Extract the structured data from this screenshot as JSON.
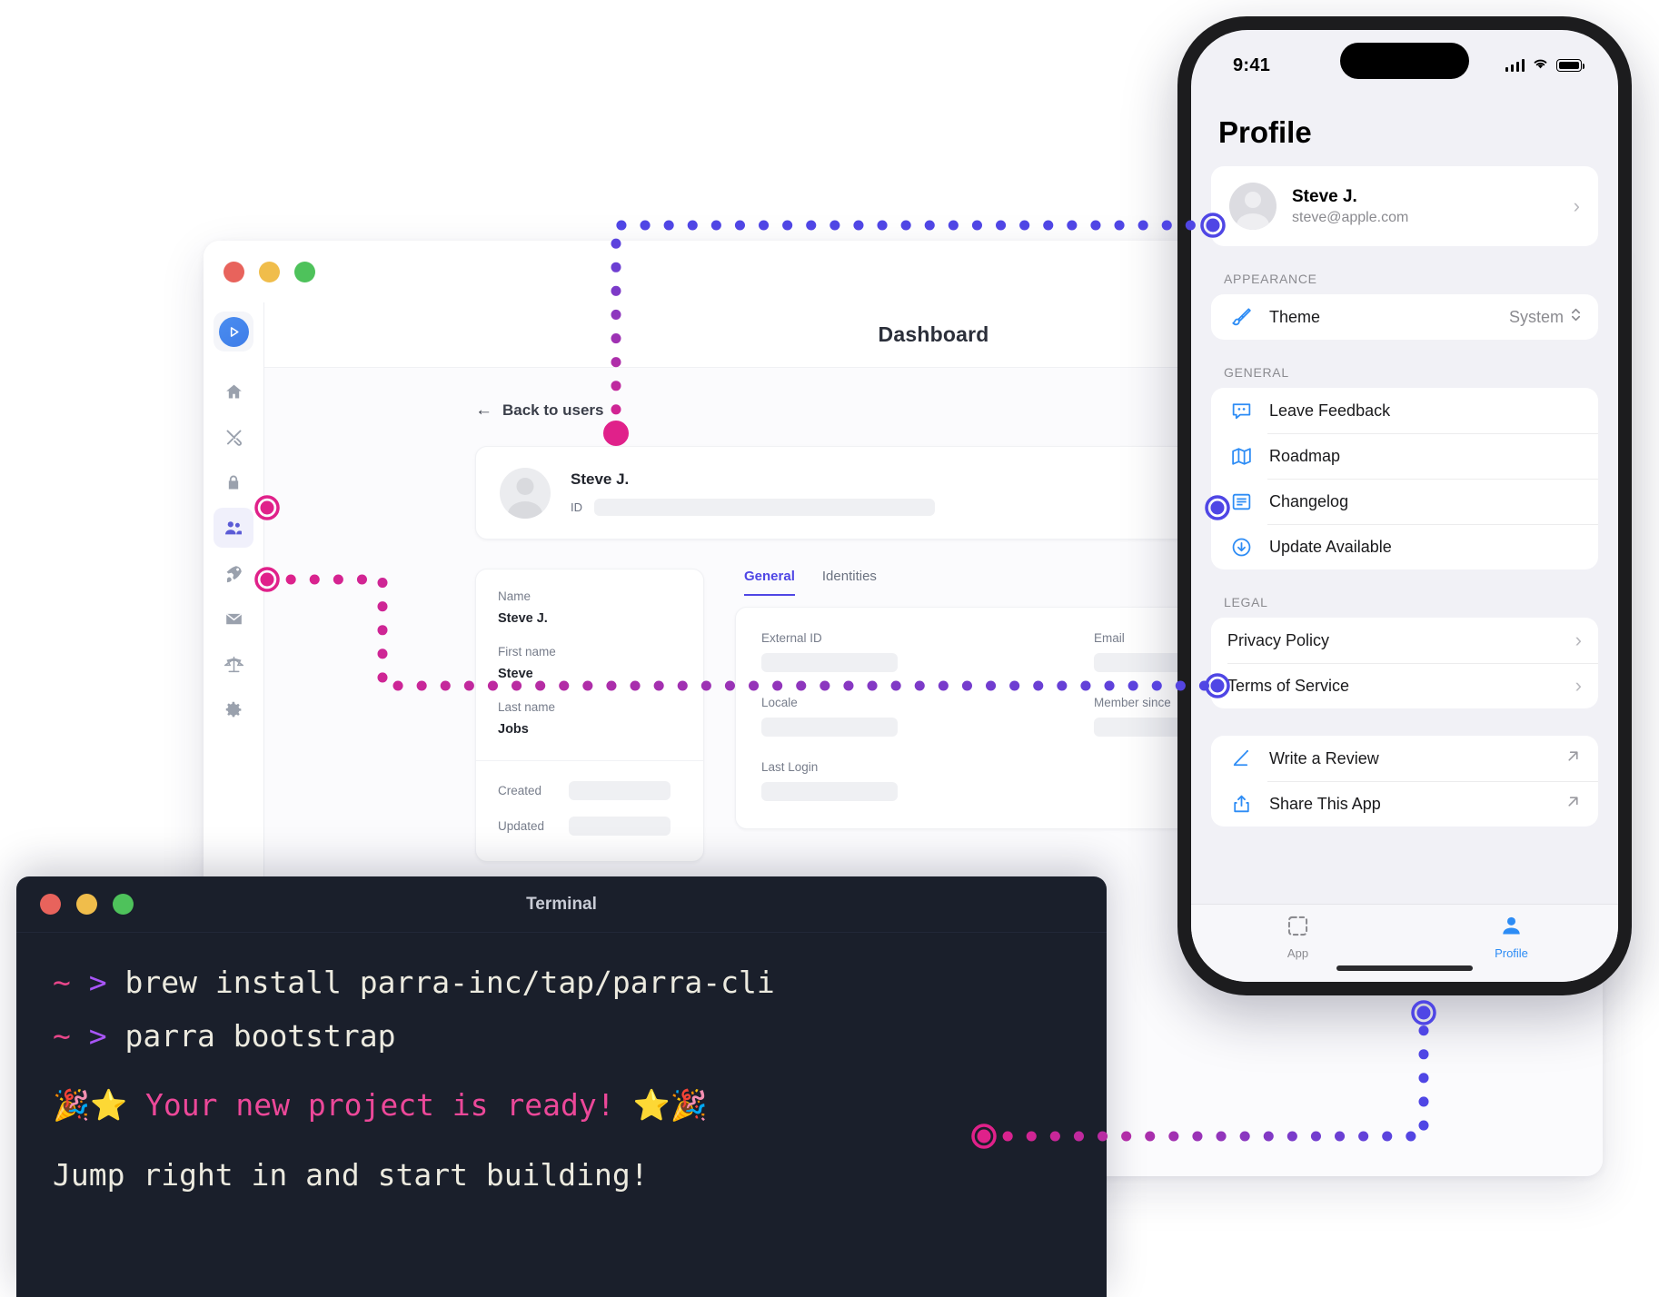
{
  "desktop": {
    "window_title": "Dashboard",
    "traffic_lights": [
      "close-red",
      "minimize-yellow",
      "maximize-green"
    ],
    "sidebar_icons": [
      {
        "name": "parra-logo-icon",
        "active": true
      },
      {
        "name": "home-icon",
        "active": false
      },
      {
        "name": "tools-icon",
        "active": false
      },
      {
        "name": "lock-icon",
        "active": false
      },
      {
        "name": "users-icon",
        "active": true
      },
      {
        "name": "rocket-icon",
        "active": false
      },
      {
        "name": "mail-icon",
        "active": false
      },
      {
        "name": "legal-scales-icon",
        "active": false
      },
      {
        "name": "settings-gear-icon",
        "active": false
      }
    ],
    "back_link": "Back to users",
    "back_arrow": "←",
    "user_card": {
      "name": "Steve J.",
      "id_label": "ID",
      "id_value": ""
    },
    "left_panel": [
      {
        "label": "Name",
        "value": "Steve J."
      },
      {
        "label": "First name",
        "value": "Steve"
      },
      {
        "label": "Last name",
        "value": "Jobs"
      }
    ],
    "left_panel_meta": [
      {
        "label": "Created",
        "value": ""
      },
      {
        "label": "Updated",
        "value": ""
      }
    ],
    "tabs": [
      {
        "label": "General",
        "active": true
      },
      {
        "label": "Identities",
        "active": false
      }
    ],
    "tab_fields": [
      {
        "label": "External ID",
        "value": ""
      },
      {
        "label": "Email",
        "value": ""
      },
      {
        "label": "Locale",
        "value": ""
      },
      {
        "label": "Member since",
        "value": ""
      },
      {
        "label": "Last Login",
        "value": ""
      }
    ]
  },
  "phone": {
    "status_bar": {
      "time": "9:41",
      "cellular": "signal-bars-icon",
      "wifi": "wifi-icon",
      "battery": "battery-full-icon"
    },
    "screen_title": "Profile",
    "profile": {
      "name": "Steve J.",
      "email": "steve@apple.com",
      "chevron": "›"
    },
    "sections": [
      {
        "header": "APPEARANCE",
        "rows": [
          {
            "icon": "paintbrush-icon",
            "label": "Theme",
            "value": "System",
            "accessory": "updown-chevron-icon"
          }
        ]
      },
      {
        "header": "GENERAL",
        "rows": [
          {
            "icon": "feedback-bubble-icon",
            "label": "Leave Feedback",
            "value": "",
            "accessory": ""
          },
          {
            "icon": "map-icon",
            "label": "Roadmap",
            "value": "",
            "accessory": ""
          },
          {
            "icon": "changelog-doc-icon",
            "label": "Changelog",
            "value": "",
            "accessory": ""
          },
          {
            "icon": "download-circle-icon",
            "label": "Update Available",
            "value": "",
            "accessory": ""
          }
        ]
      },
      {
        "header": "LEGAL",
        "rows": [
          {
            "icon": "",
            "label": "Privacy Policy",
            "value": "",
            "accessory": "chevron-right-icon"
          },
          {
            "icon": "",
            "label": "Terms of Service",
            "value": "",
            "accessory": "chevron-right-icon"
          }
        ]
      },
      {
        "header": "",
        "rows": [
          {
            "icon": "pencil-review-icon",
            "label": "Write a Review",
            "value": "",
            "accessory": "external-link-icon"
          },
          {
            "icon": "share-icon",
            "label": "Share This App",
            "value": "",
            "accessory": "external-link-icon"
          }
        ]
      }
    ],
    "tabbar": [
      {
        "icon": "app-placeholder-icon",
        "label": "App",
        "active": false
      },
      {
        "icon": "person-icon",
        "label": "Profile",
        "active": true
      }
    ]
  },
  "terminal": {
    "title": "Terminal",
    "traffic_lights": [
      "close-red",
      "minimize-yellow",
      "maximize-green"
    ],
    "lines": [
      {
        "prompt_tilde": "~",
        "prompt_gt": ">",
        "command": "brew install parra-inc/tap/parra-cli"
      },
      {
        "prompt_tilde": "~",
        "prompt_gt": ">",
        "command": "parra bootstrap"
      }
    ],
    "success_line": "🎉⭐ Your new project is ready! ⭐🎉",
    "closing_line": "Jump right in and start building!"
  },
  "colors": {
    "connector_pink": "#e0218a",
    "connector_purple": "#4f46e5",
    "accent_blue": "#2d8cf5",
    "tab_active": "#4f46e5",
    "terminal_bg": "#1a1f2b",
    "ready_text": "#ec4899"
  }
}
